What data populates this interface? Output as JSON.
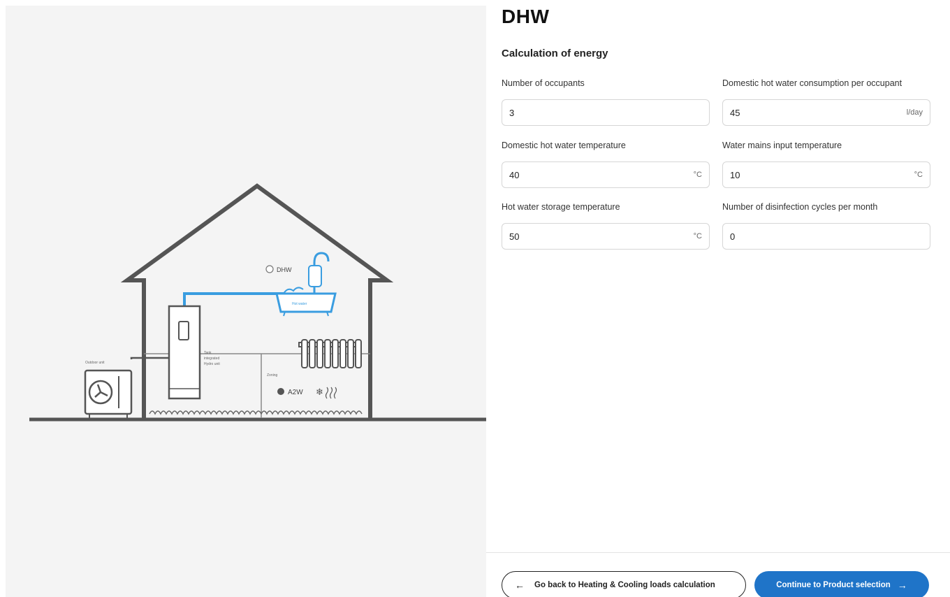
{
  "page": {
    "title": "DHW",
    "section_title": "Calculation of energy"
  },
  "diagram": {
    "dhw_label": "DHW",
    "bathtub_label": "Hot water",
    "outdoor_unit_label": "Outdoor unit",
    "hydro_unit_label": [
      "Tank",
      "integrated",
      "Hydro unit"
    ],
    "zoning_label": "Zoning",
    "a2w_label": "A2W",
    "line_color": "#555555",
    "pipe_color": "#3a9de0"
  },
  "fields": {
    "occupants": {
      "label": "Number of occupants",
      "value": "3",
      "unit": ""
    },
    "consumption": {
      "label": "Domestic hot water consumption per occupant",
      "value": "45",
      "unit": "l/day"
    },
    "dhw_temp": {
      "label": "Domestic hot water temperature",
      "value": "40",
      "unit": "°C"
    },
    "mains_temp": {
      "label": "Water mains input temperature",
      "value": "10",
      "unit": "°C"
    },
    "storage_temp": {
      "label": "Hot water storage temperature",
      "value": "50",
      "unit": "°C"
    },
    "disinfection": {
      "label": "Number of disinfection cycles per month",
      "value": "0",
      "unit": ""
    }
  },
  "footer": {
    "back_label": "Go back to Heating & Cooling loads calculation",
    "next_label": "Continue to Product selection",
    "back_arrow": "←",
    "next_arrow": "→",
    "accent_color": "#1f74c8"
  }
}
